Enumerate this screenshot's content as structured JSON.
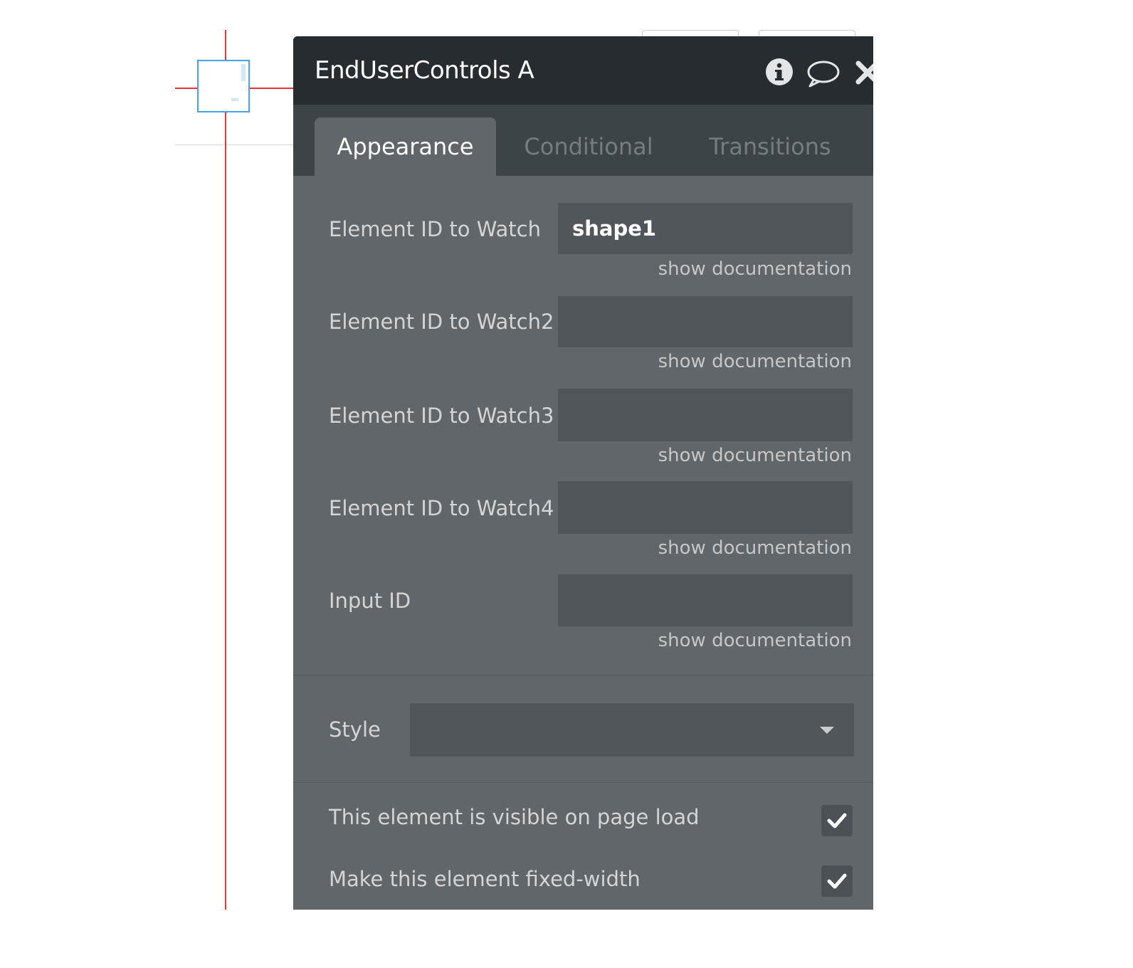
{
  "panel": {
    "title": "EndUserControls A",
    "header_icons": [
      "info-icon",
      "comment-icon",
      "close-icon"
    ]
  },
  "tabs": [
    {
      "label": "Appearance",
      "active": true
    },
    {
      "label": "Conditional",
      "active": false
    },
    {
      "label": "Transitions",
      "active": false
    }
  ],
  "fields": [
    {
      "label": "Element ID to Watch",
      "value": "shape1",
      "doc": "show documentation"
    },
    {
      "label": "Element ID to Watch2",
      "value": "",
      "doc": "show documentation"
    },
    {
      "label": "Element ID to Watch3",
      "value": "",
      "doc": "show documentation"
    },
    {
      "label": "Element ID to Watch4",
      "value": "",
      "doc": "show documentation"
    },
    {
      "label": "Input ID",
      "value": "",
      "doc": "show documentation"
    }
  ],
  "style": {
    "label": "Style",
    "value": ""
  },
  "checks": [
    {
      "label": "This element is visible on page load",
      "checked": true
    },
    {
      "label": "Make this element fixed-width",
      "checked": true
    }
  ],
  "colors": {
    "header_bg": "#262c2f",
    "panel_bg": "#60666a",
    "input_bg": "#50565a",
    "guide_red": "#e8333a",
    "selection_blue": "#4aa3e8"
  }
}
